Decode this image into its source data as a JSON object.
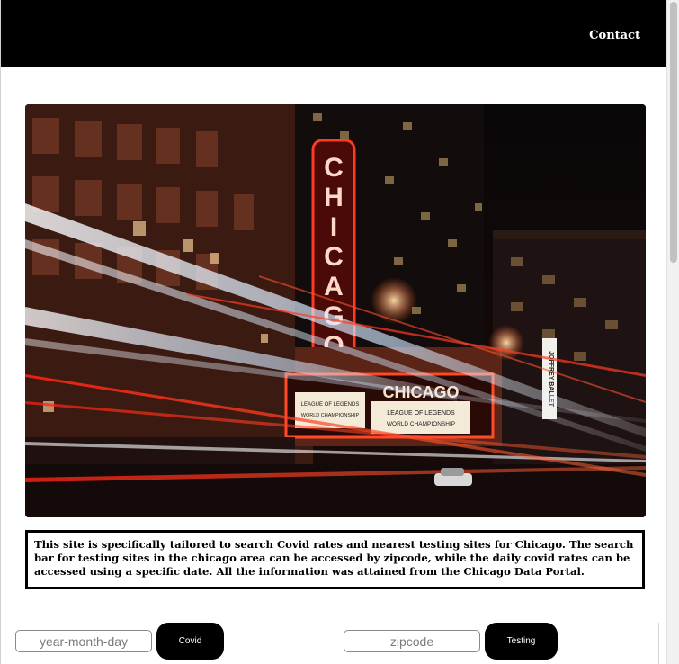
{
  "nav": {
    "contact_label": "Contact"
  },
  "hero": {
    "image_name": "chicago-theatre-night-photo",
    "signs": {
      "vertical": "CHICAGO",
      "marquee": "CHICAGO",
      "marquee_left_1": "LEAGUE OF LEGENDS",
      "marquee_left_2": "WORLD CHAMPIONSHIP",
      "marquee_right_1": "LEAGUE OF LEGENDS",
      "marquee_right_2": "WORLD CHAMPIONSHIP",
      "side_banner": "JOFFREY BALLET"
    }
  },
  "info": {
    "text": "This site is specifically tailored to search Covid rates and nearest testing sites for Chicago. The search bar for testing sites in the chicago area can be accessed by zipcode, while the daily covid rates can be accessed using a specific date. All the information was attained from the Chicago Data Portal."
  },
  "search": {
    "date_placeholder": "year-month-day",
    "covid_button": "Covid",
    "zip_placeholder": "zipcode",
    "testing_button": "Testing"
  },
  "colors": {
    "navbar": "#000000",
    "button": "#000000",
    "neon_red": "#ff3a22"
  }
}
